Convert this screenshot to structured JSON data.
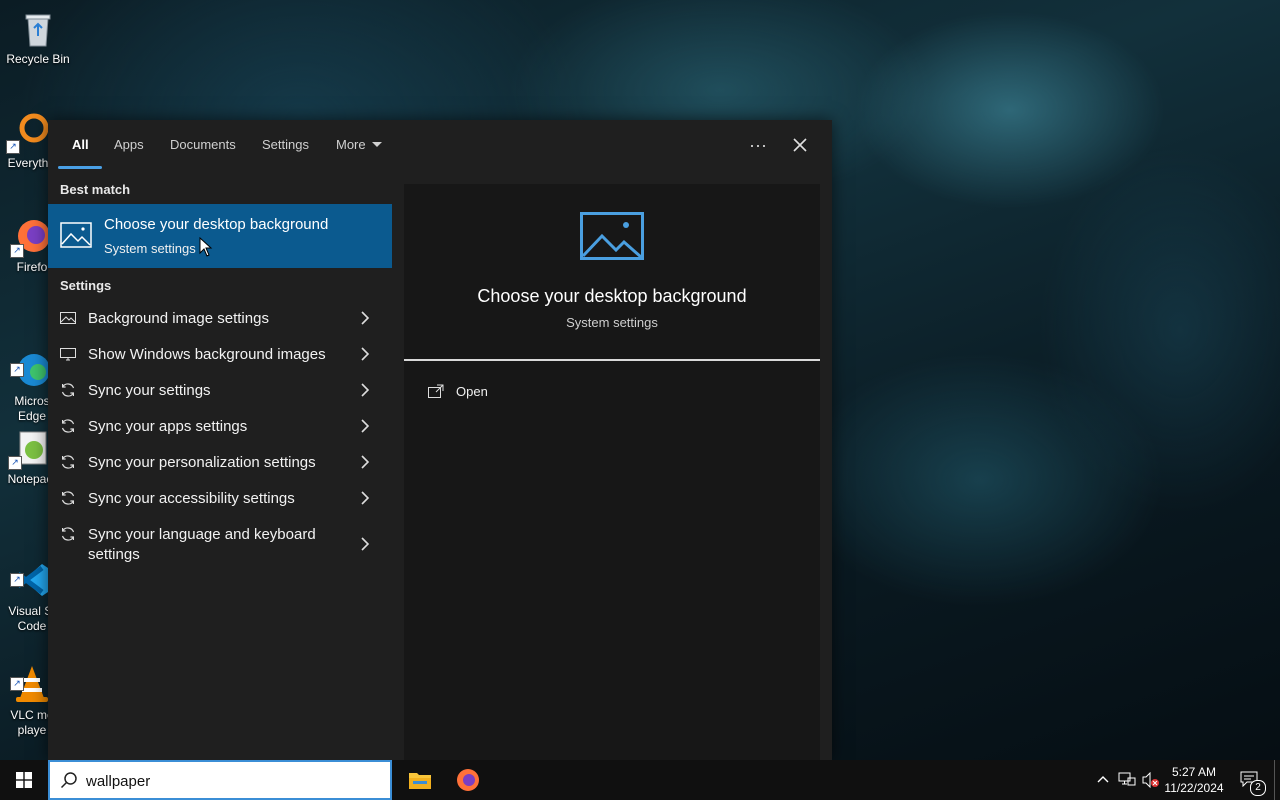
{
  "desktop": {
    "icons": [
      {
        "label": "Recycle Bin",
        "icon": "recycle-bin-icon"
      },
      {
        "label": "Everyth",
        "icon": "everything-search-icon"
      },
      {
        "label": "Firefo",
        "icon": "firefox-icon"
      },
      {
        "label": "Micros\nEdge",
        "icon": "edge-icon"
      },
      {
        "label": "Notepac",
        "icon": "notepad-plus-plus-icon"
      },
      {
        "label": "Visual St\nCode",
        "icon": "vscode-icon"
      },
      {
        "label": "VLC me\nplaye",
        "icon": "vlc-icon"
      }
    ]
  },
  "search_panel": {
    "tabs": {
      "all": "All",
      "apps": "Apps",
      "documents": "Documents",
      "settings": "Settings",
      "more": "More"
    },
    "more_options_label": "···",
    "close_label": "✕",
    "best_match": {
      "heading": "Best match",
      "title": "Choose your desktop background",
      "subtitle": "System settings",
      "icon": "picture-icon"
    },
    "settings_heading": "Settings",
    "settings_items": [
      {
        "label": "Background image settings",
        "icon": "picture-icon"
      },
      {
        "label": "Show Windows background images",
        "icon": "monitor-icon"
      },
      {
        "label": "Sync your settings",
        "icon": "sync-icon"
      },
      {
        "label": "Sync your apps settings",
        "icon": "sync-icon"
      },
      {
        "label": "Sync your personalization settings",
        "icon": "sync-icon"
      },
      {
        "label": "Sync your accessibility settings",
        "icon": "sync-icon"
      },
      {
        "label": "Sync your language and keyboard settings",
        "icon": "sync-icon"
      }
    ],
    "preview": {
      "title": "Choose your desktop background",
      "subtitle": "System settings",
      "open_label": "Open"
    }
  },
  "taskbar": {
    "search_value": "wallpaper",
    "pinned": [
      "file-explorer-icon",
      "firefox-icon"
    ],
    "clock_time": "5:27 AM",
    "clock_date": "11/22/2024",
    "notification_count": "2"
  },
  "colors": {
    "accent": "#0b5a8f",
    "tab_underline": "#4aa0e6",
    "panel_bg": "#1f1f1f",
    "preview_bg": "#171717",
    "taskbar_bg": "#101010"
  }
}
